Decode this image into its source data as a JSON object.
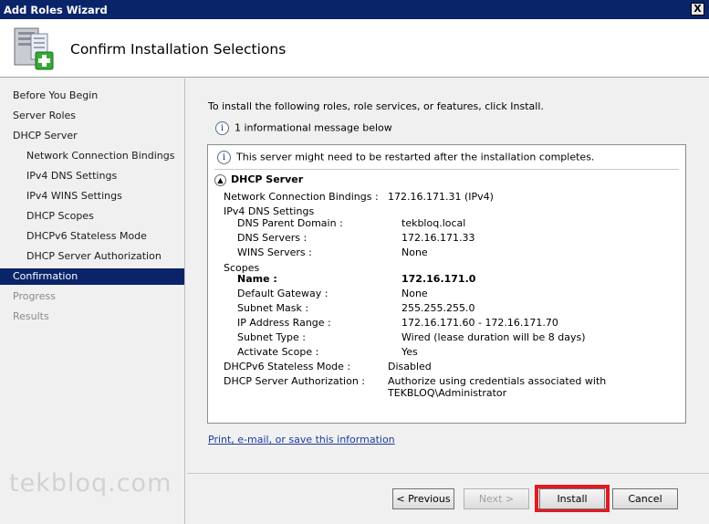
{
  "window": {
    "title": "Add Roles Wizard",
    "close_label": "X"
  },
  "header": {
    "title": "Confirm Installation Selections",
    "icon": "server-add-icon"
  },
  "sidebar": {
    "items": [
      {
        "label": "Before You Begin"
      },
      {
        "label": "Server Roles"
      },
      {
        "label": "DHCP Server"
      },
      {
        "label": "Network Connection Bindings"
      },
      {
        "label": "IPv4 DNS Settings"
      },
      {
        "label": "IPv4 WINS Settings"
      },
      {
        "label": "DHCP Scopes"
      },
      {
        "label": "DHCPv6 Stateless Mode"
      },
      {
        "label": "DHCP Server Authorization"
      },
      {
        "label": "Confirmation"
      },
      {
        "label": "Progress"
      },
      {
        "label": "Results"
      }
    ],
    "watermark": "tekbloq.com"
  },
  "main": {
    "intro": "To install the following roles, role services, or features, click Install.",
    "info_message": "1 informational message below",
    "details": {
      "restart_message": "This server might need to be restarted after the installation completes.",
      "section_title": "DHCP Server",
      "network_bindings_label": "Network Connection Bindings :",
      "network_bindings_value": "172.16.171.31 (IPv4)",
      "ipv4_dns_label": "IPv4 DNS Settings",
      "dns_parent_domain_label": "DNS Parent Domain :",
      "dns_parent_domain_value": "tekbloq.local",
      "dns_servers_label": "DNS Servers :",
      "dns_servers_value": "172.16.171.33",
      "wins_servers_label": "WINS Servers :",
      "wins_servers_value": "None",
      "scopes_label": "Scopes",
      "scope_name_label": "Name :",
      "scope_name_value": "172.16.171.0",
      "default_gateway_label": "Default Gateway :",
      "default_gateway_value": "None",
      "subnet_mask_label": "Subnet Mask :",
      "subnet_mask_value": "255.255.255.0",
      "ip_range_label": "IP Address Range :",
      "ip_range_value": "172.16.171.60 - 172.16.171.70",
      "subnet_type_label": "Subnet Type :",
      "subnet_type_value": "Wired (lease duration will be 8 days)",
      "activate_scope_label": "Activate Scope :",
      "activate_scope_value": "Yes",
      "dhcpv6_label": "DHCPv6 Stateless Mode :",
      "dhcpv6_value": "Disabled",
      "authorization_label": "DHCP Server Authorization :",
      "authorization_value_line1": "Authorize using credentials associated with",
      "authorization_value_line2": "TEKBLOQ\\Administrator"
    },
    "print_link": "Print, e-mail, or save this information"
  },
  "footer": {
    "previous": "< Previous",
    "next": "Next >",
    "install": "Install",
    "cancel": "Cancel"
  },
  "colors": {
    "title_bar": "#0a246a",
    "active_nav": "#0a246a",
    "install_highlight": "#e01b24",
    "link": "#1a3c9e"
  }
}
